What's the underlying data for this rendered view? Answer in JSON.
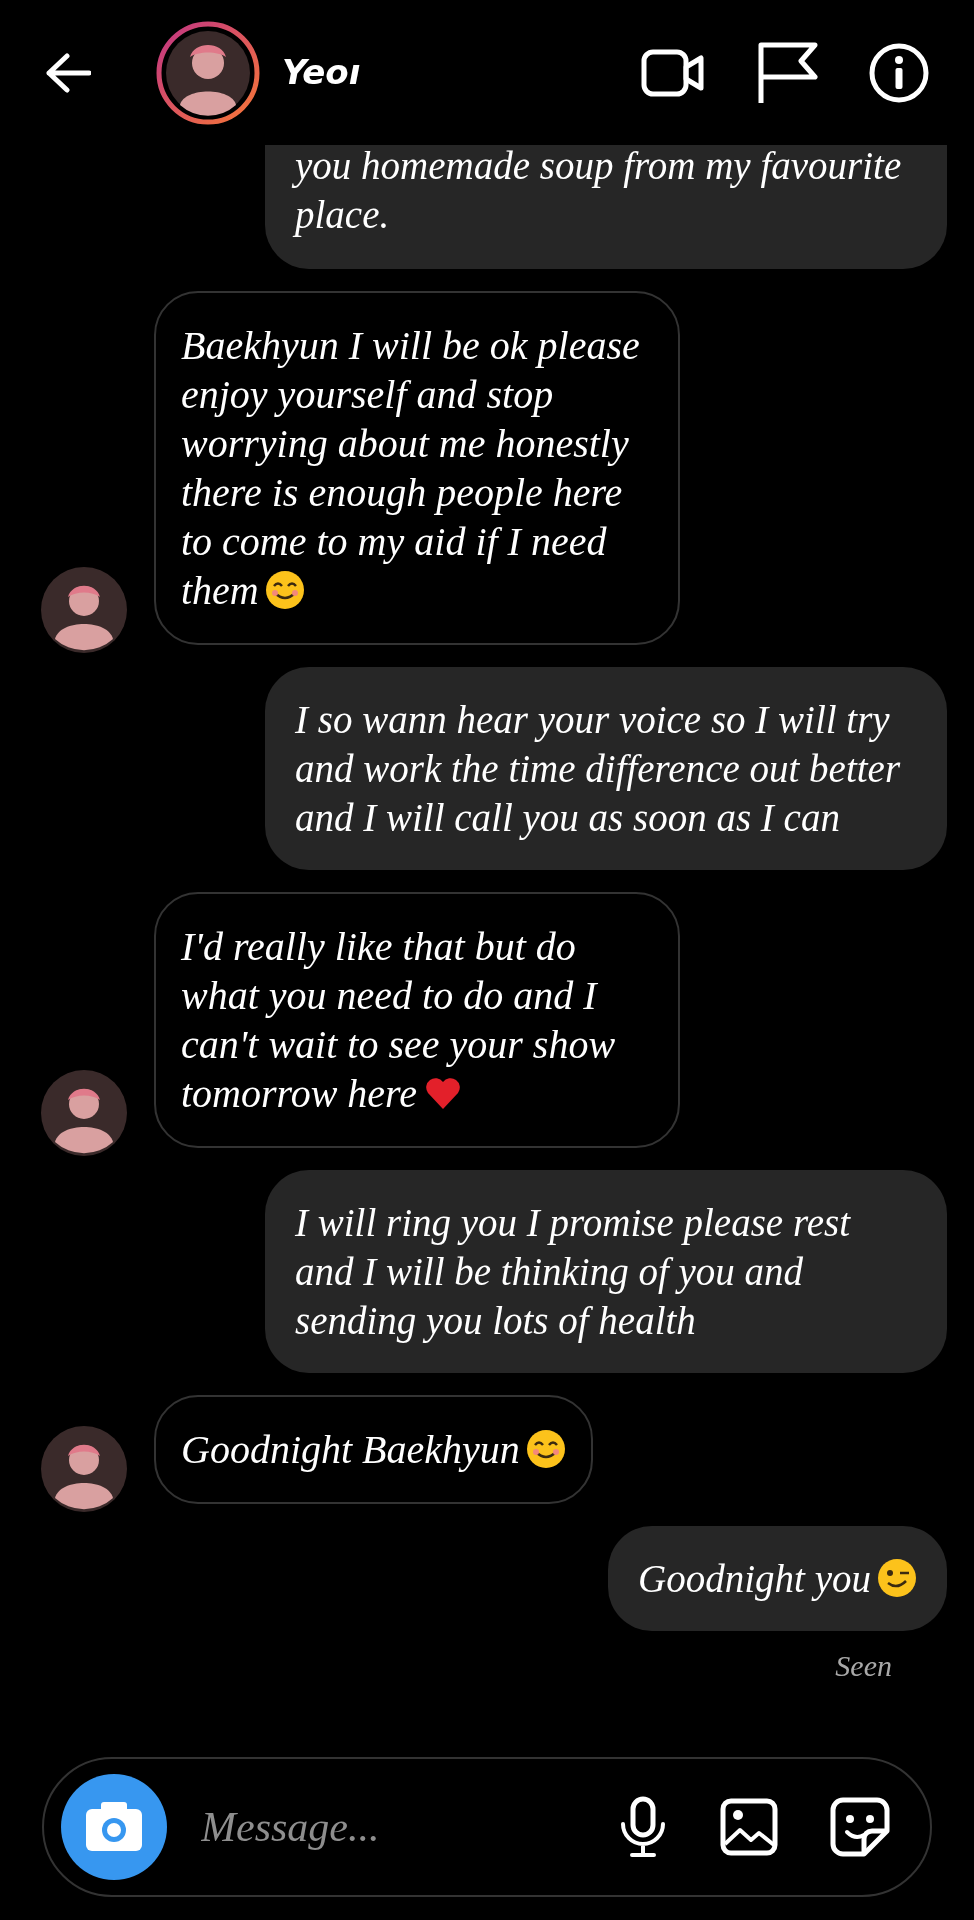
{
  "header": {
    "name": "Yeoı"
  },
  "messages": [
    {
      "kind": "sent",
      "text": "you homemade soup from my favourite place.",
      "cut_top": true
    },
    {
      "kind": "received",
      "text": "Baekhyun I will be ok please enjoy yourself and stop worrying about me honestly there is enough people here to come to my aid if I need them",
      "emoji": {
        "kind": "smile"
      },
      "avatar": true
    },
    {
      "kind": "sent",
      "text": "I so wann hear your voice so I will try and work the time difference out better and I will call you as soon as I can"
    },
    {
      "kind": "received",
      "text": "I'd really like that but do what you need to do and I can't wait to see your show tomorrow here",
      "emoji": {
        "kind": "heart"
      },
      "avatar": true
    },
    {
      "kind": "sent",
      "text": "I will ring you I promise please rest and I will be thinking of you and sending you lots of health"
    },
    {
      "kind": "received",
      "text": "Goodnight Baekhyun",
      "emoji": {
        "kind": "smile"
      },
      "avatar": true
    },
    {
      "kind": "sent",
      "text": "Goodnight you",
      "emoji": {
        "kind": "wink"
      }
    }
  ],
  "seen": "Seen",
  "composer": {
    "placeholder": "Message..."
  }
}
